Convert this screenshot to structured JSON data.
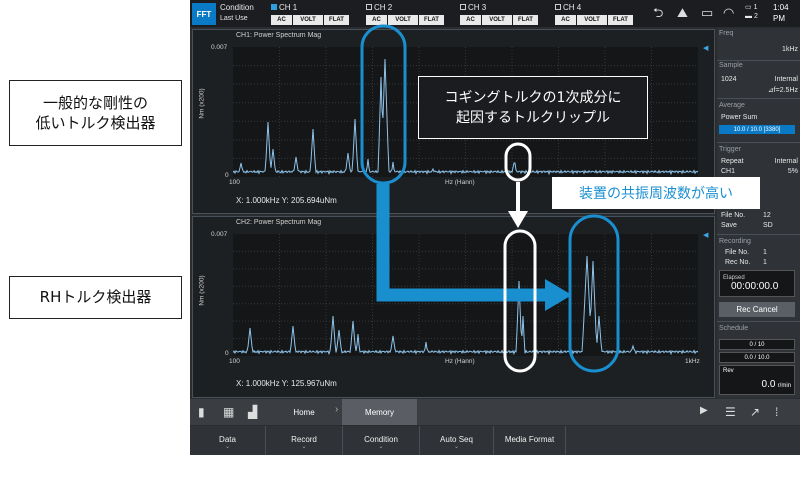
{
  "labels": {
    "left_top": [
      "一般的な剛性の",
      "低いトルク検出器"
    ],
    "left_bottom": "RHトルク検出器",
    "callout": [
      "コギングトルクの1次成分に",
      "起因するトルクリップル"
    ],
    "resonance": "装置の共振周波数が高い"
  },
  "topbar": {
    "mode": "FFT",
    "condition_label": "Condition",
    "last_use_label": "Last Use",
    "channels": [
      {
        "name": "CH 1",
        "buttons": [
          "AC",
          "VOLT",
          "FLAT"
        ]
      },
      {
        "name": "CH 2",
        "buttons": [
          "AC",
          "VOLT",
          "FLAT"
        ]
      },
      {
        "name": "CH 3",
        "buttons": [
          "AC",
          "VOLT",
          "FLAT"
        ]
      },
      {
        "name": "CH 4",
        "buttons": [
          "AC",
          "VOLT",
          "FLAT"
        ]
      }
    ],
    "battery1": "1",
    "battery2": "2",
    "time": "1:04",
    "ampm": "PM"
  },
  "panels": [
    {
      "title": "CH1: Power Spectrum Mag",
      "y_label": "Nm (x200)",
      "y_top": "0.007",
      "y_bottom": "0",
      "x_left": "100",
      "x_center": "Hz (Hann)",
      "x_right": "",
      "readout": "X: 1.000kHz Y: 205.694uNm"
    },
    {
      "title": "CH2: Power Spectrum Mag",
      "y_label": "Nm (x200)",
      "y_top": "0.007",
      "y_bottom": "0",
      "x_left": "100",
      "x_center": "Hz (Hann)",
      "x_right": "1kHz",
      "readout": "X: 1.000kHz Y: 125.967uNm"
    }
  ],
  "sidebar": {
    "freq_label": "Freq",
    "freq_value": "1kHz",
    "sample_label": "Sample",
    "sample_count": "1024",
    "sample_mode": "Internal",
    "sample_df": "⊿f=2.5Hz",
    "average_label": "Average",
    "average_mode": "Power Sum",
    "average_progress": "10.0 / 10.0 [3380]",
    "trigger_label": "Trigger",
    "trigger_mode": "Repeat",
    "trigger_source": "Internal",
    "trigger_ch": "CH1",
    "trigger_level": "5%",
    "file_no_label": "File No.",
    "file_no": "12",
    "save_label": "Save",
    "save_value": "SD",
    "recording_label": "Recording",
    "rec_file_label": "File No.",
    "rec_file": "1",
    "rec_no_label": "Rec No.",
    "rec_no": "1",
    "elapsed_label": "Elapsed",
    "elapsed_value": "00:00:00.0",
    "rec_cancel": "Rec Cancel",
    "schedule_label": "Schedule",
    "schedule_1": "0 / 10",
    "schedule_2": "0.0 / 10.0",
    "rev_label": "Rev",
    "rev_value": "0.0",
    "rev_unit": "r/min"
  },
  "nav": {
    "home": "Home",
    "memory": "Memory"
  },
  "menu": [
    "Data",
    "Record",
    "Condition",
    "Auto Seq",
    "Media Format"
  ],
  "colors": {
    "accent": "#0a79c6",
    "trace": "#8fc4ea",
    "highlight": "#1a8fd0"
  }
}
